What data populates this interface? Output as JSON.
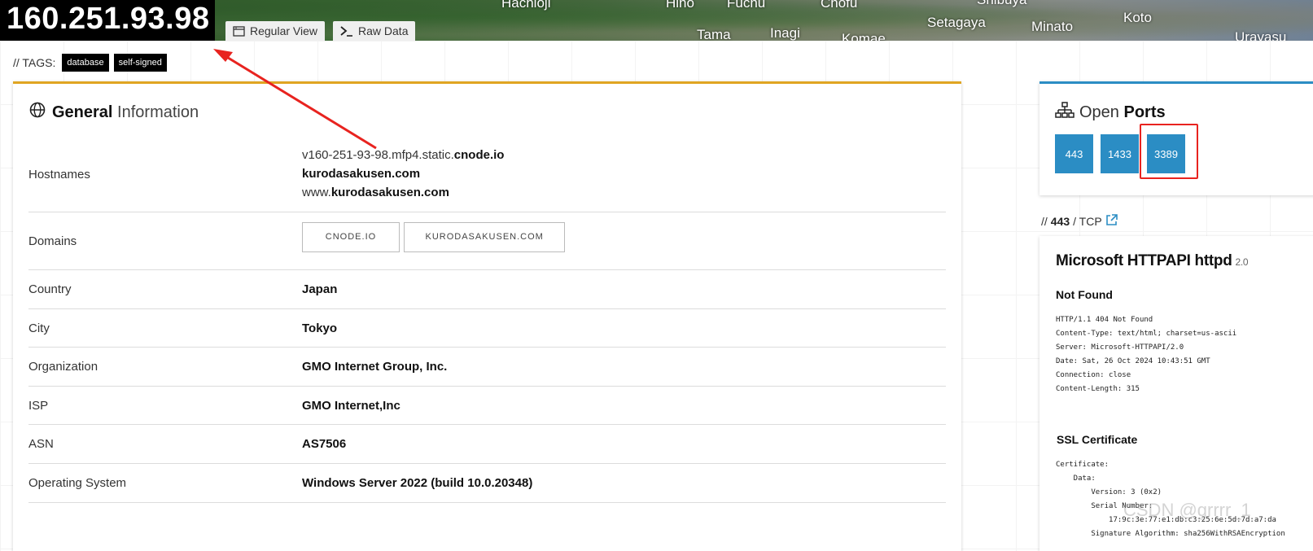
{
  "header": {
    "ip": "160.251.93.98",
    "map_labels": [
      "Hachioji",
      "Hino",
      "Fuchu",
      "Chofu",
      "Shibuya",
      "Tama",
      "Inagi",
      "Komae",
      "Setagaya",
      "Minato",
      "Koto",
      "Urayasu"
    ],
    "tabs": [
      {
        "label": "Regular View",
        "icon": "window-icon"
      },
      {
        "label": "Raw Data",
        "icon": "terminal-icon"
      }
    ]
  },
  "tags": {
    "label": "// TAGS:",
    "items": [
      "database",
      "self-signed"
    ]
  },
  "general": {
    "title_bold": "General",
    "title_light": "Information",
    "accent_color": "#e0a522",
    "hostnames_label": "Hostnames",
    "hostnames": [
      {
        "plain": "v160-251-93-98.mfp4.static.",
        "strong": "cnode.io"
      },
      {
        "plain": "",
        "strong": "kurodasakusen.com"
      },
      {
        "plain": "www.",
        "strong": "kurodasakusen.com"
      }
    ],
    "domains_label": "Domains",
    "domains": [
      "CNODE.IO",
      "KURODASAKUSEN.COM"
    ],
    "rows": [
      {
        "key": "Country",
        "value": "Japan"
      },
      {
        "key": "City",
        "value": "Tokyo"
      },
      {
        "key": "Organization",
        "value": "GMO Internet Group, Inc."
      },
      {
        "key": "ISP",
        "value": "GMO Internet,Inc"
      },
      {
        "key": "ASN",
        "value": "AS7506"
      },
      {
        "key": "Operating System",
        "value": "Windows Server 2022 (build 10.0.20348)"
      }
    ]
  },
  "ports": {
    "title_light": "Open",
    "title_bold": "Ports",
    "accent_color": "#2b8dc4",
    "items": [
      "443",
      "1433",
      "3389"
    ],
    "highlighted": "3389"
  },
  "service": {
    "prefix": "//",
    "port": "443",
    "protocol": "/ TCP",
    "name": "Microsoft HTTPAPI httpd",
    "version": "2.0",
    "status": "Not Found",
    "response": "HTTP/1.1 404 Not Found\nContent-Type: text/html; charset=us-ascii\nServer: Microsoft-HTTPAPI/2.0\nDate: Sat, 26 Oct 2024 10:43:51 GMT\nConnection: close\nContent-Length: 315",
    "ssl_title": "SSL Certificate",
    "certificate": "Certificate:\n    Data:\n        Version: 3 (0x2)\n        Serial Number:\n            17:9c:3e:77:e1:db:c3:25:6e:5d:7d:a7:da\n        Signature Algorithm: sha256WithRSAEncryption"
  },
  "watermark": "CSDN @grrrr_1"
}
